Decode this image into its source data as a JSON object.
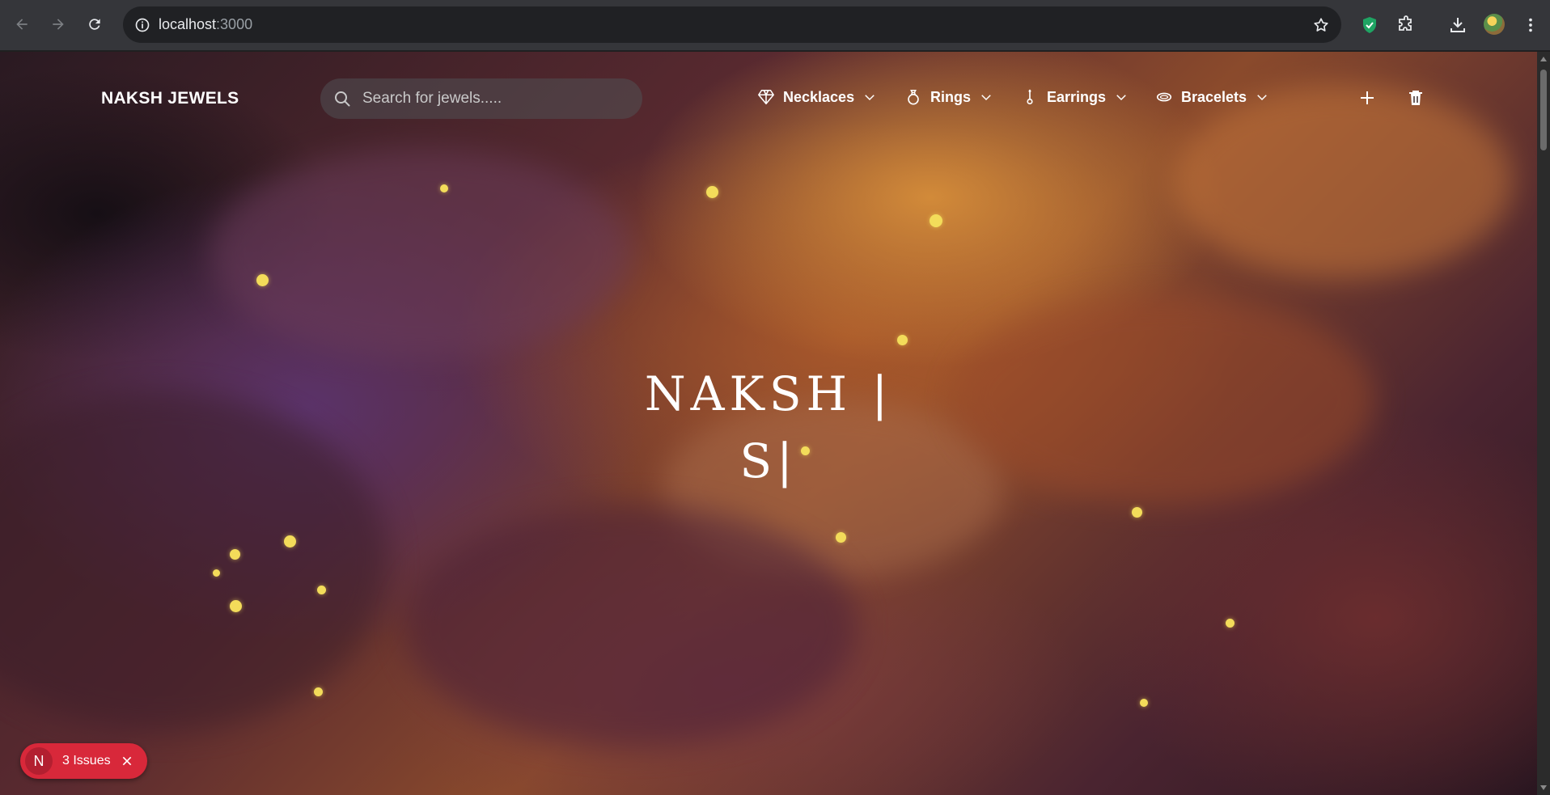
{
  "browser": {
    "url_host": "localhost",
    "url_port": ":3000"
  },
  "site": {
    "brand": "NAKSH JEWELS",
    "search_placeholder": "Search for jewels.....",
    "menu": [
      {
        "label": "Necklaces",
        "icon": "diamond-icon"
      },
      {
        "label": "Rings",
        "icon": "ring-icon"
      },
      {
        "label": "Earrings",
        "icon": "earring-icon"
      },
      {
        "label": "Bracelets",
        "icon": "bracelet-icon"
      }
    ],
    "actions": [
      "plus-icon",
      "trash-icon"
    ]
  },
  "hero": {
    "line1": "NAKSH |",
    "line2": "S|"
  },
  "dev_overlay": {
    "logo": "N",
    "issues_label": "3 Issues"
  },
  "colors": {
    "sparkle": "#f3dc5a",
    "issues_badge": "#d8283a",
    "browser_chrome": "#35363a"
  }
}
